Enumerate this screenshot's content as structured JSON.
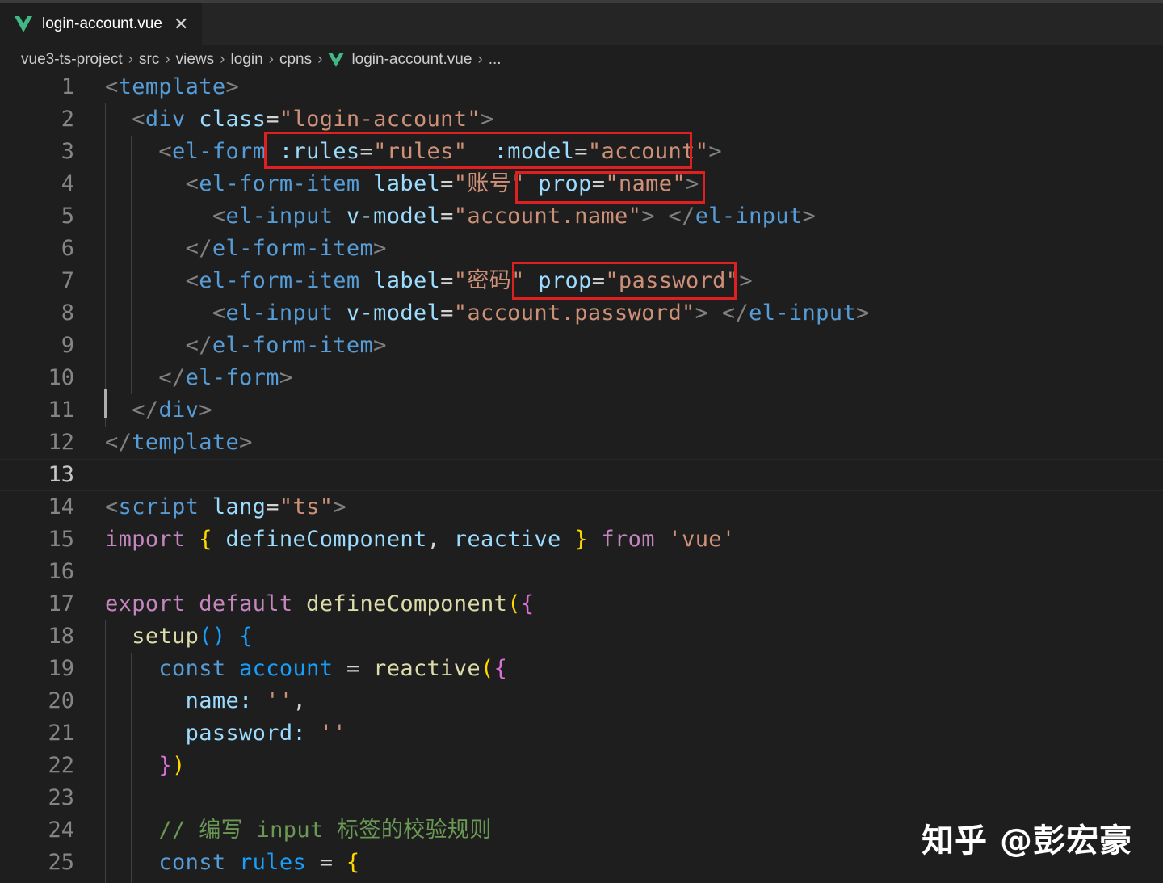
{
  "tab": {
    "label": "login-account.vue",
    "close": "✕",
    "icon": "vue-icon"
  },
  "breadcrumb": {
    "items": [
      "vue3-ts-project",
      "src",
      "views",
      "login",
      "cpns"
    ],
    "file": "login-account.vue",
    "ellipsis": "...",
    "separator": "›"
  },
  "editor": {
    "current_line": 13,
    "lines": [
      {
        "n": "1"
      },
      {
        "n": "2"
      },
      {
        "n": "3"
      },
      {
        "n": "4"
      },
      {
        "n": "5"
      },
      {
        "n": "6"
      },
      {
        "n": "7"
      },
      {
        "n": "8"
      },
      {
        "n": "9"
      },
      {
        "n": "10"
      },
      {
        "n": "11"
      },
      {
        "n": "12"
      },
      {
        "n": "13"
      },
      {
        "n": "14"
      },
      {
        "n": "15"
      },
      {
        "n": "16"
      },
      {
        "n": "17"
      },
      {
        "n": "18"
      },
      {
        "n": "19"
      },
      {
        "n": "20"
      },
      {
        "n": "21"
      },
      {
        "n": "22"
      },
      {
        "n": "23"
      },
      {
        "n": "24"
      },
      {
        "n": "25"
      }
    ],
    "code": {
      "l1": {
        "lt": "<",
        "tag": "template",
        "gt": ">"
      },
      "l2": {
        "tag": "div",
        "attr": "class",
        "val": "\"login-account\""
      },
      "l3": {
        "tag": "el-form",
        "rules_attr": ":rules",
        "rules_val": "\"rules\"",
        "model_attr": ":model",
        "model_val": "\"account\""
      },
      "l4": {
        "tag": "el-form-item",
        "label_attr": "label",
        "label_val": "\"账号\"",
        "prop_attr": "prop",
        "prop_val": "\"name\""
      },
      "l5": {
        "tag": "el-input",
        "attr": "v-model",
        "val": "\"account.name\"",
        "close_tag": "el-input"
      },
      "l6": {
        "tag": "el-form-item"
      },
      "l7": {
        "tag": "el-form-item",
        "label_attr": "label",
        "label_val": "\"密码\"",
        "prop_attr": "prop",
        "prop_val": "\"password\""
      },
      "l8": {
        "tag": "el-input",
        "attr": "v-model",
        "val": "\"account.password\"",
        "close_tag": "el-input"
      },
      "l9": {
        "tag": "el-form-item"
      },
      "l10": {
        "tag": "el-form"
      },
      "l11": {
        "tag": "div"
      },
      "l12": {
        "tag": "template"
      },
      "l14": {
        "tag": "script",
        "attr": "lang",
        "val": "\"ts\""
      },
      "l15": {
        "import": "import",
        "open": "{",
        "n1": "defineComponent",
        "comma": ",",
        "n2": "reactive",
        "close": "}",
        "from": "from",
        "src": "'vue'"
      },
      "l17": {
        "export": "export",
        "default": "default",
        "fn": "defineComponent",
        "paren": "(",
        "brace": "{"
      },
      "l18": {
        "fn": "setup",
        "parens": "()",
        "brace": "{"
      },
      "l19": {
        "const": "const",
        "name": "account",
        "eq": "=",
        "fn": "reactive",
        "paren": "(",
        "brace": "{"
      },
      "l20": {
        "key": "name:",
        "val": "''",
        "comma": ","
      },
      "l21": {
        "key": "password:",
        "val": "''"
      },
      "l22": {
        "brace": "}",
        "paren": ")"
      },
      "l24": {
        "comment": "// 编写 input 标签的校验规则"
      },
      "l25": {
        "const": "const",
        "name": "rules",
        "eq": "=",
        "brace": "{"
      }
    }
  },
  "highlight_color": "#e02020",
  "watermark": "知乎 @彭宏豪"
}
